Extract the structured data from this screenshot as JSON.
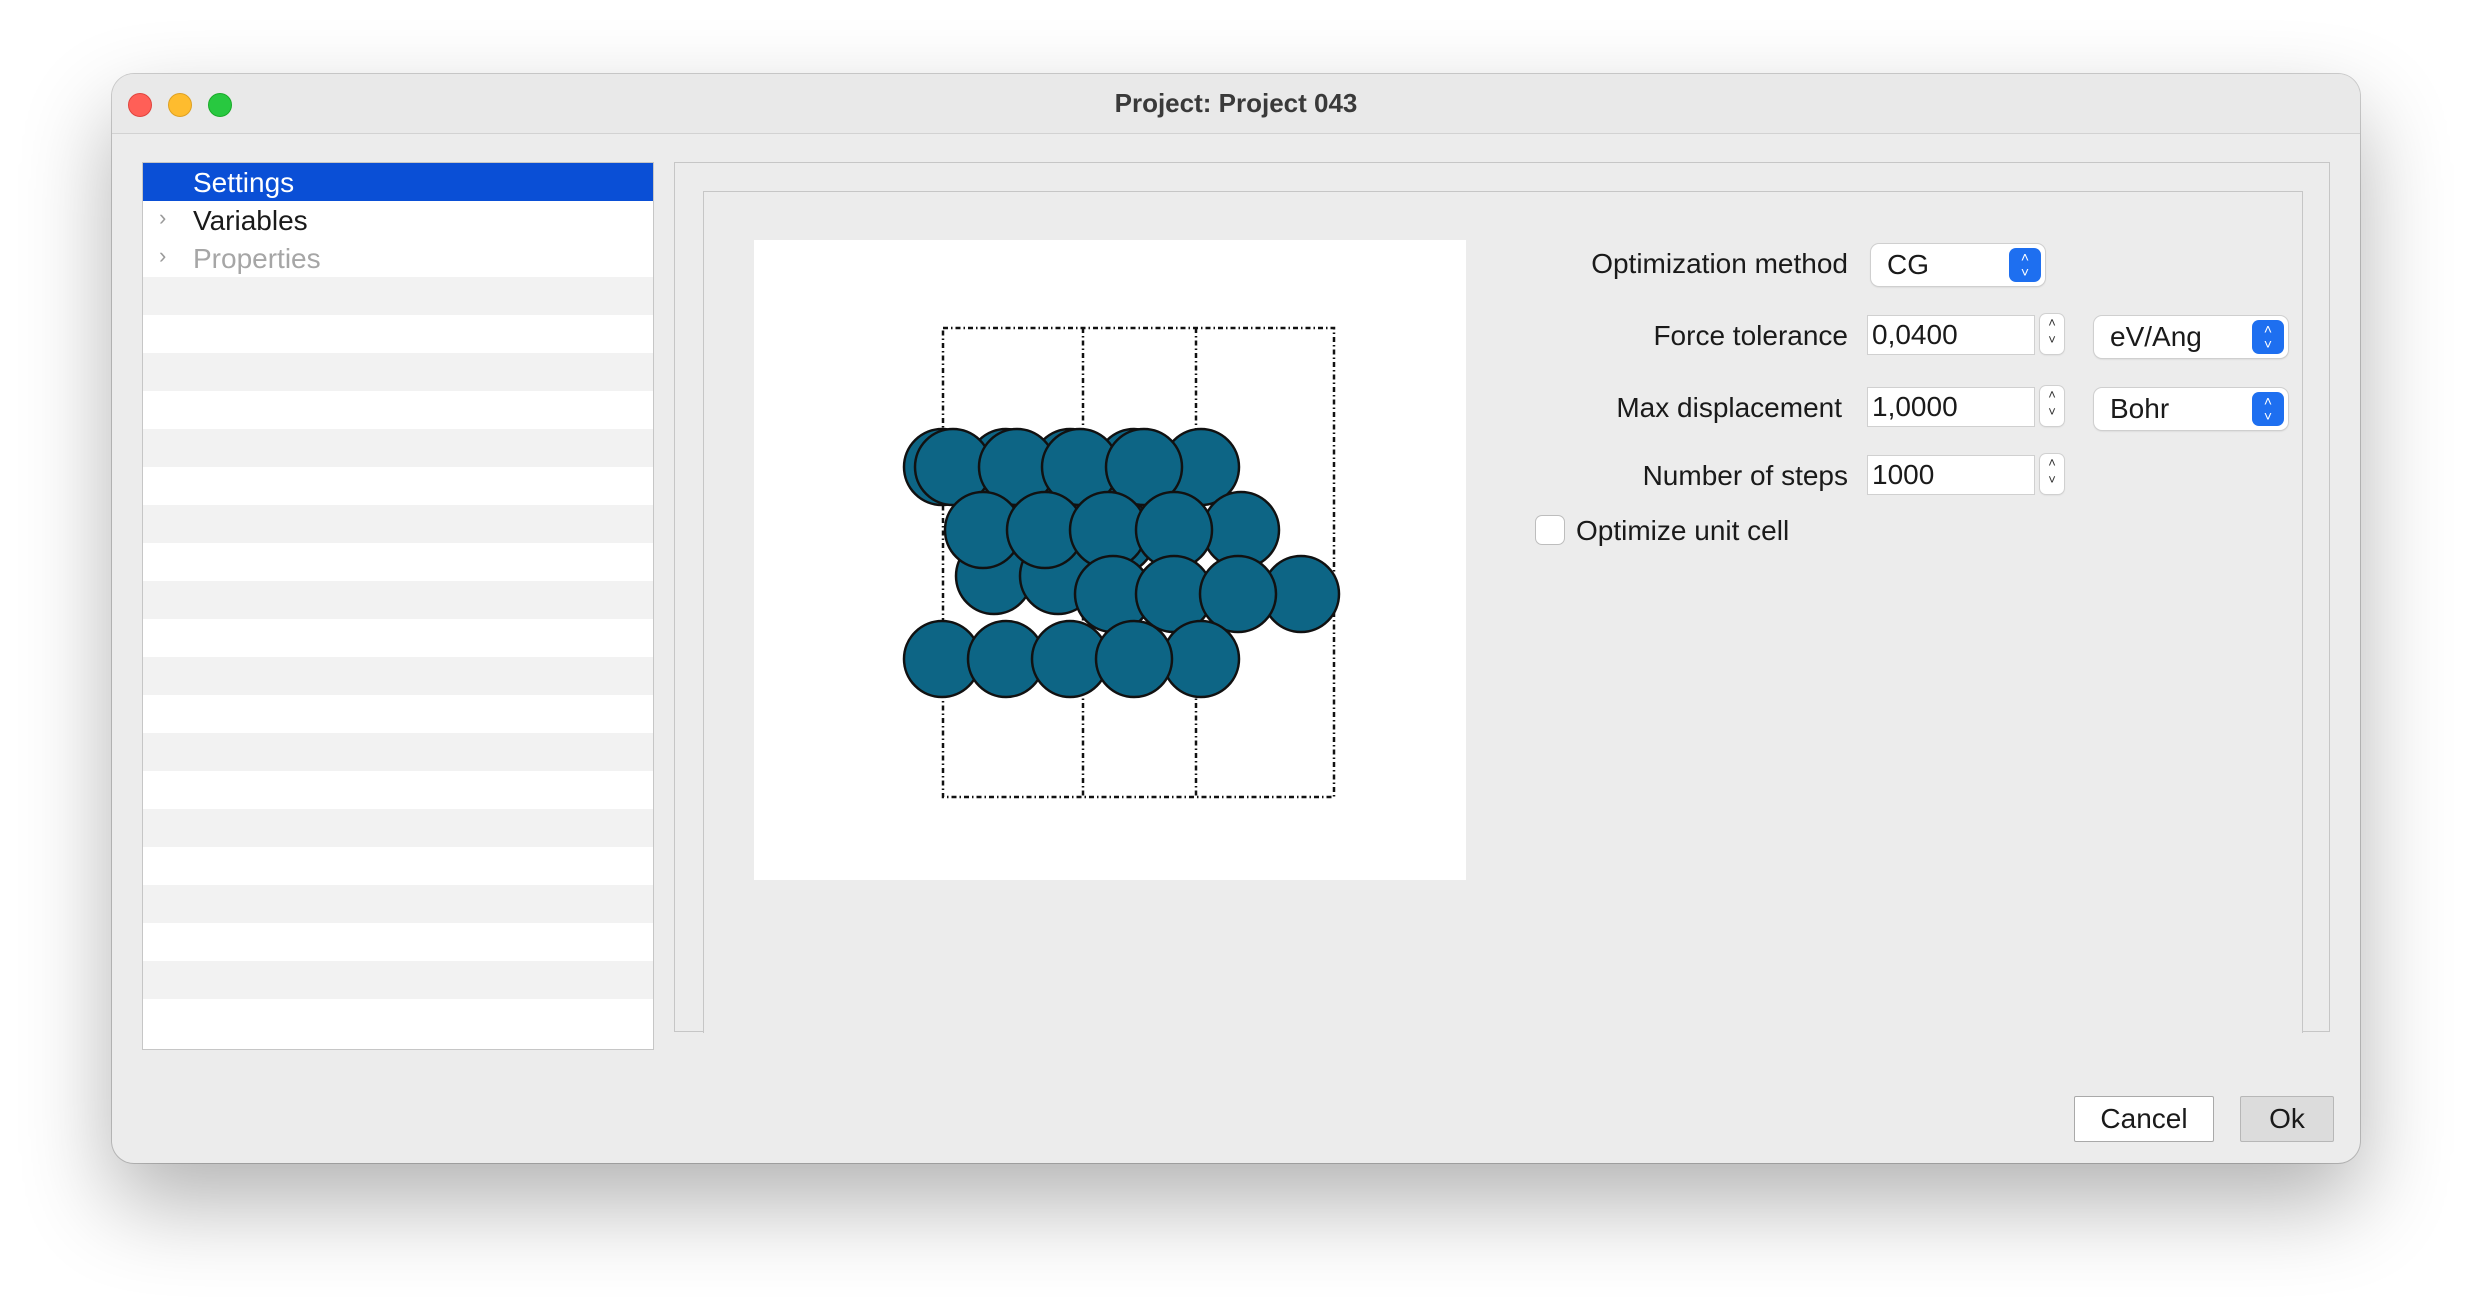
{
  "window": {
    "title": "Project: Project 043"
  },
  "sidebar": {
    "items": [
      {
        "label": "Settings",
        "selected": true,
        "expandable": false,
        "enabled": true
      },
      {
        "label": "Variables",
        "selected": false,
        "expandable": true,
        "enabled": true
      },
      {
        "label": "Properties",
        "selected": false,
        "expandable": true,
        "enabled": false
      }
    ]
  },
  "preview": {
    "atom_color": "#0d6585",
    "outline_color": "#111111",
    "background": "#ffffff"
  },
  "form": {
    "optimization_method": {
      "label": "Optimization method",
      "value": "CG"
    },
    "force_tolerance": {
      "label": "Force tolerance",
      "value": "0,0400",
      "unit": "eV/Ang"
    },
    "max_displacement": {
      "label": "Max displacement",
      "value": "1,0000",
      "unit": "Bohr"
    },
    "number_of_steps": {
      "label": "Number of  steps",
      "value": "1000"
    },
    "optimize_unit_cell": {
      "label": "Optimize unit cell",
      "checked": false
    }
  },
  "buttons": {
    "cancel": "Cancel",
    "ok": "Ok"
  },
  "colors": {
    "selection": "#0a4fd6",
    "accent": "#1e6ff0"
  }
}
